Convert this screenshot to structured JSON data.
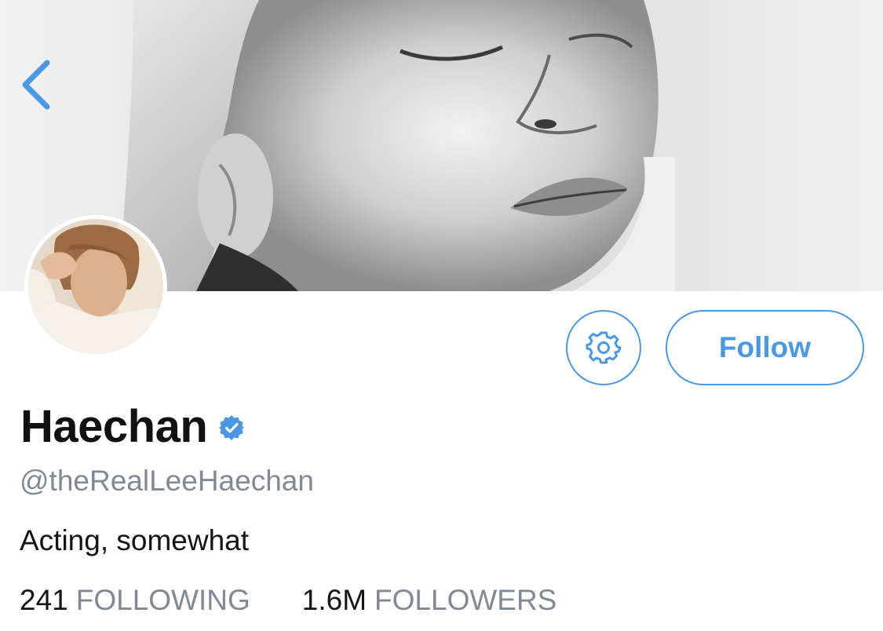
{
  "header": {
    "back_icon": "chevron-left-icon",
    "accent_color": "#4a98e3"
  },
  "profile": {
    "display_name": "Haechan",
    "verified_icon": "verified-badge-icon",
    "handle": "@theRealLeeHaechan",
    "bio": "Acting, somewhat",
    "following_count": "241",
    "following_label": "FOLLOWING",
    "followers_count": "1.6M",
    "followers_label": "FOLLOWERS"
  },
  "actions": {
    "settings_icon": "gear-icon",
    "follow_label": "Follow"
  }
}
